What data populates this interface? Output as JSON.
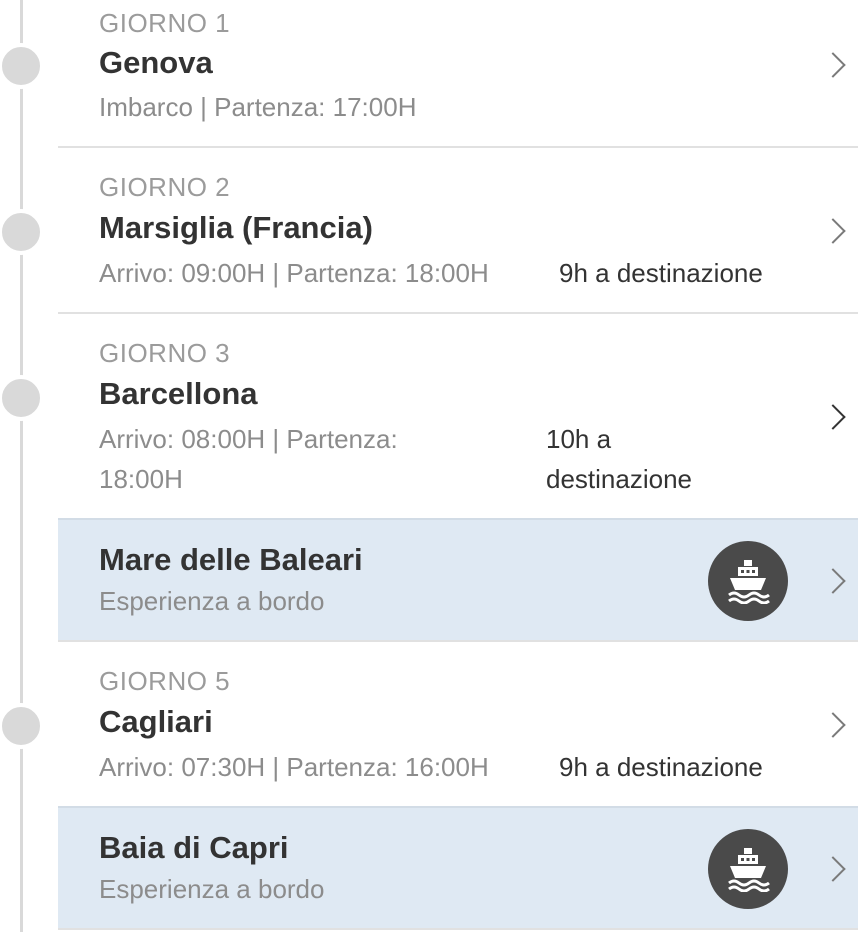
{
  "itinerary": [
    {
      "day": "GIORNO 1",
      "city": "Genova",
      "times": "Imbarco | Partenza: 17:00H",
      "destination": ""
    },
    {
      "day": "GIORNO 2",
      "city": "Marsiglia (Francia)",
      "times": "Arrivo: 09:00H | Partenza: 18:00H",
      "destination": "9h a destinazione"
    },
    {
      "day": "GIORNO 3",
      "city": "Barcellona",
      "times_line1": "Arrivo: 08:00H | Partenza:",
      "times_line2": "18:00H",
      "destination_line1": "10h a",
      "destination_line2": "destinazione"
    },
    {
      "city": "Mare delle Baleari",
      "subtitle": "Esperienza a bordo",
      "icon": "ship-icon"
    },
    {
      "day": "GIORNO 5",
      "city": "Cagliari",
      "times": "Arrivo: 07:30H | Partenza: 16:00H",
      "destination": "9h a destinazione"
    },
    {
      "city": "Baia di Capri",
      "subtitle": "Esperienza a bordo",
      "icon": "ship-icon"
    }
  ],
  "colors": {
    "sea_background": "#dfe9f3",
    "timeline": "#d9d9d9",
    "badge": "#4a4a4a"
  }
}
